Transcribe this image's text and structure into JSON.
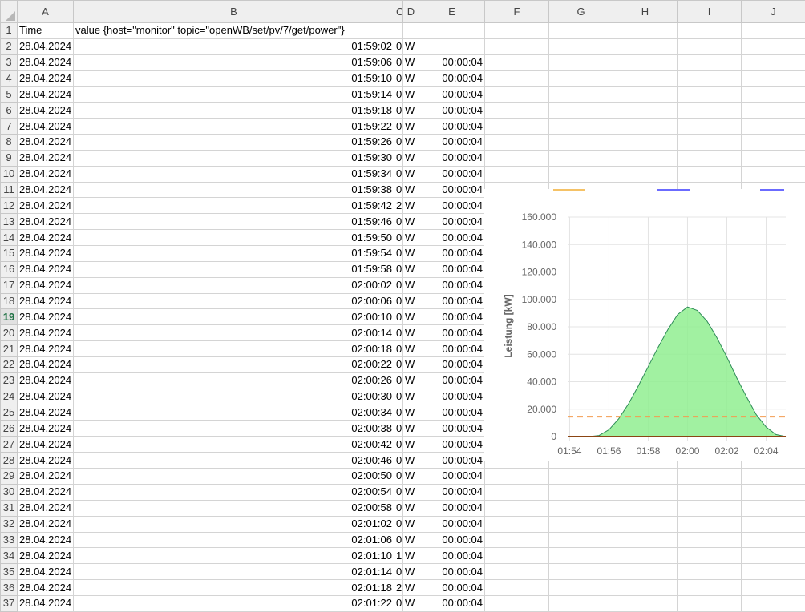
{
  "columns": [
    "A",
    "B",
    "C",
    "D",
    "E",
    "F",
    "G",
    "H",
    "I",
    "J"
  ],
  "active_row": "19",
  "header_row": {
    "num": "1",
    "a": "Time",
    "b": "value {host=\"monitor\"  topic=\"openWB/set/pv/7/get/power\"}"
  },
  "rows": [
    {
      "num": "2",
      "date": "28.04.2024",
      "time": "01:59:02",
      "value": "0",
      "unit": "W",
      "delta": ""
    },
    {
      "num": "3",
      "date": "28.04.2024",
      "time": "01:59:06",
      "value": "0",
      "unit": "W",
      "delta": "00:00:04"
    },
    {
      "num": "4",
      "date": "28.04.2024",
      "time": "01:59:10",
      "value": "0",
      "unit": "W",
      "delta": "00:00:04"
    },
    {
      "num": "5",
      "date": "28.04.2024",
      "time": "01:59:14",
      "value": "0",
      "unit": "W",
      "delta": "00:00:04"
    },
    {
      "num": "6",
      "date": "28.04.2024",
      "time": "01:59:18",
      "value": "0",
      "unit": "W",
      "delta": "00:00:04"
    },
    {
      "num": "7",
      "date": "28.04.2024",
      "time": "01:59:22",
      "value": "0",
      "unit": "W",
      "delta": "00:00:04"
    },
    {
      "num": "8",
      "date": "28.04.2024",
      "time": "01:59:26",
      "value": "0",
      "unit": "W",
      "delta": "00:00:04"
    },
    {
      "num": "9",
      "date": "28.04.2024",
      "time": "01:59:30",
      "value": "0",
      "unit": "W",
      "delta": "00:00:04"
    },
    {
      "num": "10",
      "date": "28.04.2024",
      "time": "01:59:34",
      "value": "0",
      "unit": "W",
      "delta": "00:00:04"
    },
    {
      "num": "11",
      "date": "28.04.2024",
      "time": "01:59:38",
      "value": "0",
      "unit": "W",
      "delta": "00:00:04"
    },
    {
      "num": "12",
      "date": "28.04.2024",
      "time": "01:59:42",
      "value": "2",
      "unit": "W",
      "delta": "00:00:04"
    },
    {
      "num": "13",
      "date": "28.04.2024",
      "time": "01:59:46",
      "value": "0",
      "unit": "W",
      "delta": "00:00:04"
    },
    {
      "num": "14",
      "date": "28.04.2024",
      "time": "01:59:50",
      "value": "0",
      "unit": "W",
      "delta": "00:00:04"
    },
    {
      "num": "15",
      "date": "28.04.2024",
      "time": "01:59:54",
      "value": "0",
      "unit": "W",
      "delta": "00:00:04"
    },
    {
      "num": "16",
      "date": "28.04.2024",
      "time": "01:59:58",
      "value": "0",
      "unit": "W",
      "delta": "00:00:04"
    },
    {
      "num": "17",
      "date": "28.04.2024",
      "time": "02:00:02",
      "value": "0",
      "unit": "W",
      "delta": "00:00:04"
    },
    {
      "num": "18",
      "date": "28.04.2024",
      "time": "02:00:06",
      "value": "0",
      "unit": "W",
      "delta": "00:00:04"
    },
    {
      "num": "19",
      "date": "28.04.2024",
      "time": "02:00:10",
      "value": "0",
      "unit": "W",
      "delta": "00:00:04"
    },
    {
      "num": "20",
      "date": "28.04.2024",
      "time": "02:00:14",
      "value": "0",
      "unit": "W",
      "delta": "00:00:04"
    },
    {
      "num": "21",
      "date": "28.04.2024",
      "time": "02:00:18",
      "value": "0",
      "unit": "W",
      "delta": "00:00:04"
    },
    {
      "num": "22",
      "date": "28.04.2024",
      "time": "02:00:22",
      "value": "0",
      "unit": "W",
      "delta": "00:00:04"
    },
    {
      "num": "23",
      "date": "28.04.2024",
      "time": "02:00:26",
      "value": "0",
      "unit": "W",
      "delta": "00:00:04"
    },
    {
      "num": "24",
      "date": "28.04.2024",
      "time": "02:00:30",
      "value": "0",
      "unit": "W",
      "delta": "00:00:04"
    },
    {
      "num": "25",
      "date": "28.04.2024",
      "time": "02:00:34",
      "value": "0",
      "unit": "W",
      "delta": "00:00:04"
    },
    {
      "num": "26",
      "date": "28.04.2024",
      "time": "02:00:38",
      "value": "0",
      "unit": "W",
      "delta": "00:00:04"
    },
    {
      "num": "27",
      "date": "28.04.2024",
      "time": "02:00:42",
      "value": "0",
      "unit": "W",
      "delta": "00:00:04"
    },
    {
      "num": "28",
      "date": "28.04.2024",
      "time": "02:00:46",
      "value": "0",
      "unit": "W",
      "delta": "00:00:04"
    },
    {
      "num": "29",
      "date": "28.04.2024",
      "time": "02:00:50",
      "value": "0",
      "unit": "W",
      "delta": "00:00:04"
    },
    {
      "num": "30",
      "date": "28.04.2024",
      "time": "02:00:54",
      "value": "0",
      "unit": "W",
      "delta": "00:00:04"
    },
    {
      "num": "31",
      "date": "28.04.2024",
      "time": "02:00:58",
      "value": "0",
      "unit": "W",
      "delta": "00:00:04"
    },
    {
      "num": "32",
      "date": "28.04.2024",
      "time": "02:01:02",
      "value": "0",
      "unit": "W",
      "delta": "00:00:04"
    },
    {
      "num": "33",
      "date": "28.04.2024",
      "time": "02:01:06",
      "value": "0",
      "unit": "W",
      "delta": "00:00:04"
    },
    {
      "num": "34",
      "date": "28.04.2024",
      "time": "02:01:10",
      "value": "1",
      "unit": "W",
      "delta": "00:00:04"
    },
    {
      "num": "35",
      "date": "28.04.2024",
      "time": "02:01:14",
      "value": "0",
      "unit": "W",
      "delta": "00:00:04"
    },
    {
      "num": "36",
      "date": "28.04.2024",
      "time": "02:01:18",
      "value": "2",
      "unit": "W",
      "delta": "00:00:04"
    },
    {
      "num": "37",
      "date": "28.04.2024",
      "time": "02:01:22",
      "value": "0",
      "unit": "W",
      "delta": "00:00:04"
    }
  ],
  "chart_data": {
    "type": "area",
    "ylabel": "Leistung [kW]",
    "ylim": [
      0,
      160000
    ],
    "yticks": [
      "160.000",
      "140.000",
      "120.000",
      "100.000",
      "80.000",
      "60.000",
      "40.000",
      "20.000",
      "0"
    ],
    "ytick_values": [
      160000,
      140000,
      120000,
      100000,
      80000,
      60000,
      40000,
      20000,
      0
    ],
    "xlim": [
      "01:53.9",
      "02:05"
    ],
    "xticks": [
      "01:54",
      "01:56",
      "01:58",
      "02:00",
      "02:02",
      "02:04"
    ],
    "grid": true,
    "series": [
      {
        "kind": "area",
        "color": "#2e8b57",
        "fill": "#90ee90",
        "x": [
          "01:53.9",
          "01:55.0",
          "01:55.5",
          "01:56.0",
          "01:56.5",
          "01:57.0",
          "01:57.5",
          "01:58.0",
          "01:58.5",
          "01:59.0",
          "01:59.5",
          "02:00.0",
          "02:00.5",
          "02:01.0",
          "02:01.5",
          "02:02.0",
          "02:02.5",
          "02:03.0",
          "02:03.5",
          "02:04.0",
          "02:04.5",
          "02:05.0"
        ],
        "values": [
          0,
          0,
          800,
          5000,
          13000,
          24000,
          37000,
          51000,
          65000,
          78000,
          89000,
          94500,
          92000,
          84000,
          72000,
          58000,
          43000,
          29000,
          16000,
          7000,
          1500,
          0
        ]
      },
      {
        "kind": "line",
        "dashed": true,
        "color": "#f39c50",
        "x": [
          "01:53.9",
          "02:05.0"
        ],
        "values": [
          14500,
          14500
        ]
      },
      {
        "kind": "line",
        "color": "#8b4513",
        "x": [
          "01:53.9",
          "02:05.0"
        ],
        "values": [
          0,
          0
        ]
      }
    ],
    "legend_swatches": [
      "#f5c266",
      "#6b6bff",
      "#6b6bff"
    ]
  }
}
